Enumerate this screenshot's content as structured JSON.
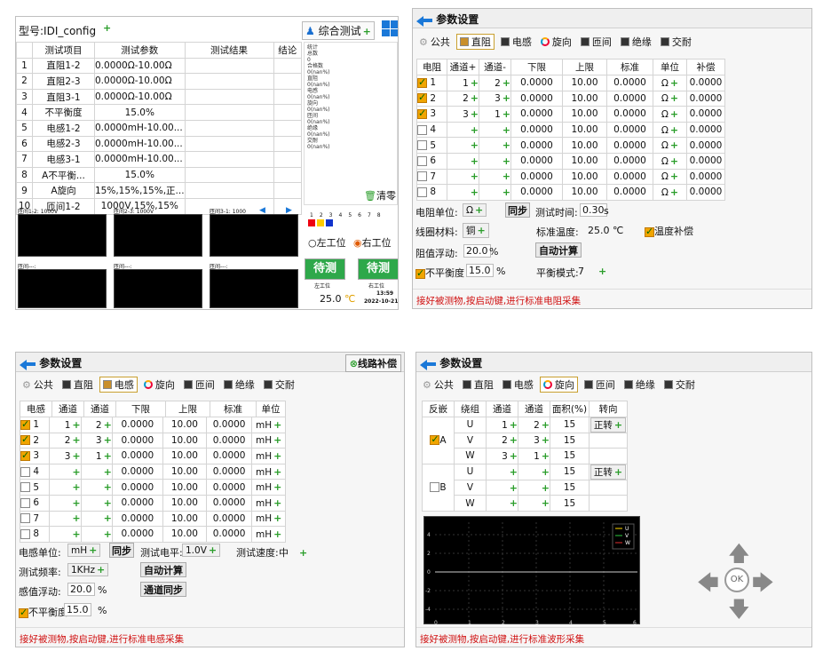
{
  "p1": {
    "model_label": "型号:",
    "model_value": "IDI_config",
    "plus": "+",
    "comp_test": "综合测试",
    "comp_plus": "+",
    "headers": [
      "测试项目",
      "测试参数",
      "测试结果",
      "结论"
    ],
    "rows": [
      [
        "1",
        "直阻1-2",
        "0.0000Ω-10.00Ω"
      ],
      [
        "2",
        "直阻2-3",
        "0.0000Ω-10.00Ω"
      ],
      [
        "3",
        "直阻3-1",
        "0.0000Ω-10.00Ω"
      ],
      [
        "4",
        "不平衡度",
        "15.0%"
      ],
      [
        "5",
        "电感1-2",
        "0.0000mH-10.00..."
      ],
      [
        "6",
        "电感2-3",
        "0.0000mH-10.00..."
      ],
      [
        "7",
        "电感3-1",
        "0.0000mH-10.00..."
      ],
      [
        "8",
        "A不平衡...",
        "15.0%"
      ],
      [
        "9",
        "A旋向",
        "15%,15%,15%,正..."
      ],
      [
        "10",
        "匝间1-2",
        "1000V,15%,15%"
      ]
    ],
    "stats": [
      [
        "统计",
        ""
      ],
      [
        "总数",
        "0"
      ],
      [
        "合格数",
        "0(nan%)"
      ],
      [
        "直阻",
        "0(nan%)"
      ],
      [
        "电感",
        "0(nan%)"
      ],
      [
        "旋向",
        "0(nan%)"
      ],
      [
        "匝间",
        "0(nan%)"
      ],
      [
        "绝缘",
        "0(nan%)"
      ],
      [
        "交耐",
        "0(nan%)"
      ]
    ],
    "clear": "清零",
    "scopes": [
      "匝间1-2: 1000V",
      "匝间2-3: 1000V",
      "匝间3-1: 1000",
      "匝间---:",
      "匝间---:",
      "匝间---:"
    ],
    "nums": [
      "1",
      "2",
      "3",
      "4",
      "5",
      "6",
      "7",
      "8"
    ],
    "left_station": "左工位",
    "right_station": "右工位",
    "wait": "待测",
    "left_label": "左工位",
    "right_label": "右工位",
    "temp": "25.0",
    "time": "13:59",
    "date": "2022-10-21"
  },
  "common": {
    "title": "参数设置",
    "tabs": [
      "公共",
      "直阻",
      "电感",
      "旋向",
      "匝间",
      "绝缘",
      "交耐"
    ]
  },
  "p2": {
    "headers": [
      "电阻",
      "通道+",
      "通道-",
      "下限",
      "上限",
      "标准",
      "单位",
      "补偿"
    ],
    "rows": [
      [
        true,
        "1",
        "1",
        "2",
        "0.0000",
        "10.00",
        "0.0000",
        "Ω",
        "0.0000"
      ],
      [
        true,
        "2",
        "2",
        "3",
        "0.0000",
        "10.00",
        "0.0000",
        "Ω",
        "0.0000"
      ],
      [
        true,
        "3",
        "3",
        "1",
        "0.0000",
        "10.00",
        "0.0000",
        "Ω",
        "0.0000"
      ],
      [
        false,
        "4",
        "",
        "",
        "0.0000",
        "10.00",
        "0.0000",
        "Ω",
        "0.0000"
      ],
      [
        false,
        "5",
        "",
        "",
        "0.0000",
        "10.00",
        "0.0000",
        "Ω",
        "0.0000"
      ],
      [
        false,
        "6",
        "",
        "",
        "0.0000",
        "10.00",
        "0.0000",
        "Ω",
        "0.0000"
      ],
      [
        false,
        "7",
        "",
        "",
        "0.0000",
        "10.00",
        "0.0000",
        "Ω",
        "0.0000"
      ],
      [
        false,
        "8",
        "",
        "",
        "0.0000",
        "10.00",
        "0.0000",
        "Ω",
        "0.0000"
      ]
    ],
    "unit_label": "电阻单位:",
    "unit": "Ω",
    "sync": "同步",
    "time_label": "测试时间:",
    "time_val": "0.30",
    "time_unit": "s",
    "mat_label": "线圈材料:",
    "mat": "铜",
    "stdtemp_label": "标准温度:",
    "stdtemp": "25.0",
    "stdtemp_unit": "℃",
    "tempcomp": "温度补偿",
    "float_label": "阻值浮动:",
    "float_val": "20.0",
    "pct": "%",
    "autocalc": "自动计算",
    "unbal": "不平衡度",
    "unbal_val": "15.0",
    "unbal_pct": "%",
    "mode_label": "平衡模式:",
    "mode": "7",
    "status": "接好被测物,按启动键,进行标准电阻采集"
  },
  "p3": {
    "comp_btn": "线路补偿",
    "headers": [
      "电感",
      "通道",
      "通道",
      "下限",
      "上限",
      "标准",
      "单位"
    ],
    "rows": [
      [
        true,
        "1",
        "1",
        "2",
        "0.0000",
        "10.00",
        "0.0000",
        "mH"
      ],
      [
        true,
        "2",
        "2",
        "3",
        "0.0000",
        "10.00",
        "0.0000",
        "mH"
      ],
      [
        true,
        "3",
        "3",
        "1",
        "0.0000",
        "10.00",
        "0.0000",
        "mH"
      ],
      [
        false,
        "4",
        "",
        "",
        "0.0000",
        "10.00",
        "0.0000",
        "mH"
      ],
      [
        false,
        "5",
        "",
        "",
        "0.0000",
        "10.00",
        "0.0000",
        "mH"
      ],
      [
        false,
        "6",
        "",
        "",
        "0.0000",
        "10.00",
        "0.0000",
        "mH"
      ],
      [
        false,
        "7",
        "",
        "",
        "0.0000",
        "10.00",
        "0.0000",
        "mH"
      ],
      [
        false,
        "8",
        "",
        "",
        "0.0000",
        "10.00",
        "0.0000",
        "mH"
      ]
    ],
    "unit_label": "电感单位:",
    "unit": "mH",
    "sync": "同步",
    "level_label": "测试电平:",
    "level": "1.0V",
    "speed_label": "测试速度:",
    "speed": "中",
    "freq_label": "测试频率:",
    "freq": "1KHz",
    "autocalc": "自动计算",
    "float_label": "感值浮动:",
    "float_val": "20.0",
    "pct": "%",
    "chsync": "通道同步",
    "unbal": "不平衡度",
    "unbal_val": "15.0",
    "unbal_pct": "%",
    "status": "接好被测物,按启动键,进行标准电感采集"
  },
  "p4": {
    "headers": [
      "反嵌",
      "绕组",
      "通道",
      "通道",
      "面积(%)",
      "转向"
    ],
    "groupA": {
      "label": "A",
      "checked": true,
      "rows": [
        [
          "U",
          "1",
          "2",
          "15"
        ],
        [
          "V",
          "2",
          "3",
          "15"
        ],
        [
          "W",
          "3",
          "1",
          "15"
        ]
      ],
      "dir": "正转"
    },
    "groupB": {
      "label": "B",
      "checked": false,
      "rows": [
        [
          "U",
          "",
          "",
          "15"
        ],
        [
          "V",
          "",
          "",
          "15"
        ],
        [
          "W",
          "",
          "",
          "15"
        ]
      ],
      "dir": "正转"
    },
    "legend": [
      "U",
      "V",
      "W"
    ],
    "yticks": [
      "4",
      "2",
      "0",
      "-2",
      "-4"
    ],
    "xticks": [
      "0",
      "1",
      "2",
      "3",
      "4",
      "5",
      "6"
    ],
    "ok": "OK",
    "status": "接好被测物,按启动键,进行标准波形采集"
  }
}
